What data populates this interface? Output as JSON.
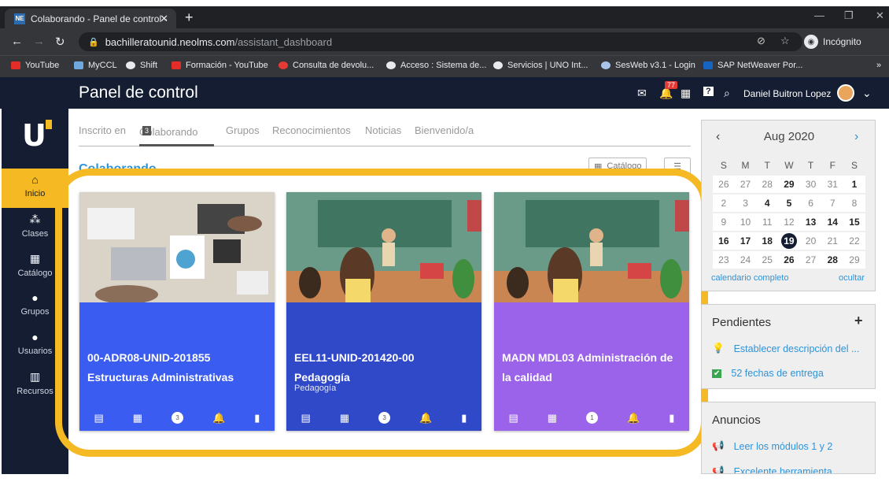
{
  "browser": {
    "tab_title": "Colaborando - Panel de control -",
    "tab_favicon": "NE",
    "url_host": "bachilleratounid.neolms.com",
    "url_path": "/assistant_dashboard",
    "incognito_label": "Incógnito",
    "bookmarks": [
      "YouTube",
      "MyCCL",
      "Shift",
      "Formación - YouTube",
      "Consulta de devolu...",
      "Acceso : Sistema de...",
      "Servicios | UNO Int...",
      "SesWeb v3.1 - Login",
      "SAP NetWeaver Por..."
    ]
  },
  "header": {
    "title": "Panel de control",
    "notifications_count": "77",
    "user_name": "Daniel Buitron Lopez"
  },
  "sidebar": {
    "items": [
      {
        "label": "Inicio",
        "icon": "home-icon"
      },
      {
        "label": "Clases",
        "icon": "classes-icon"
      },
      {
        "label": "Catálogo",
        "icon": "catalog-icon"
      },
      {
        "label": "Grupos",
        "icon": "groups-icon"
      },
      {
        "label": "Usuarios",
        "icon": "users-icon"
      },
      {
        "label": "Recursos",
        "icon": "resources-icon"
      }
    ]
  },
  "tabs": {
    "items": [
      "Inscrito en",
      "Colaborando",
      "Grupos",
      "Reconocimientos",
      "Noticias",
      "Bienvenido/a"
    ],
    "active_count": "3"
  },
  "section": {
    "title": "Colaborando",
    "catalog_label": "Catálogo"
  },
  "cards": [
    {
      "code": "00-ADR08-UNID-201855",
      "title": "Estructuras Administrativas",
      "subtitle": "",
      "badge": "3",
      "color": "#3b5cf0"
    },
    {
      "code": "EEL11-UNID-201420-00",
      "title": "Pedagogía",
      "subtitle": "Pedagogía",
      "badge": "3",
      "color": "#2f49c9"
    },
    {
      "code": "MADN MDL03 Administración de",
      "title": "la calidad",
      "subtitle": "",
      "badge": "1",
      "color": "#9b63ea"
    }
  ],
  "calendar": {
    "month": "Aug 2020",
    "dow": [
      "S",
      "M",
      "T",
      "W",
      "T",
      "F",
      "S"
    ],
    "weeks": [
      [
        "26",
        "27",
        "28",
        "29",
        "30",
        "31",
        "1"
      ],
      [
        "2",
        "3",
        "4",
        "5",
        "6",
        "7",
        "8"
      ],
      [
        "9",
        "10",
        "11",
        "12",
        "13",
        "14",
        "15"
      ],
      [
        "16",
        "17",
        "18",
        "19",
        "20",
        "21",
        "22"
      ],
      [
        "23",
        "24",
        "25",
        "26",
        "27",
        "28",
        "29"
      ]
    ],
    "today": "19",
    "full_link": "calendario completo",
    "hide_link": "ocultar"
  },
  "pendientes": {
    "title": "Pendientes",
    "items": [
      "Establecer descripción del ...",
      "52 fechas de entrega"
    ]
  },
  "anuncios": {
    "title": "Anuncios",
    "items": [
      "Leer los módulos 1 y 2",
      "Excelente herramienta."
    ]
  },
  "colors": {
    "accent": "#f4b923",
    "nav": "#141d31",
    "link": "#2f93d8"
  }
}
